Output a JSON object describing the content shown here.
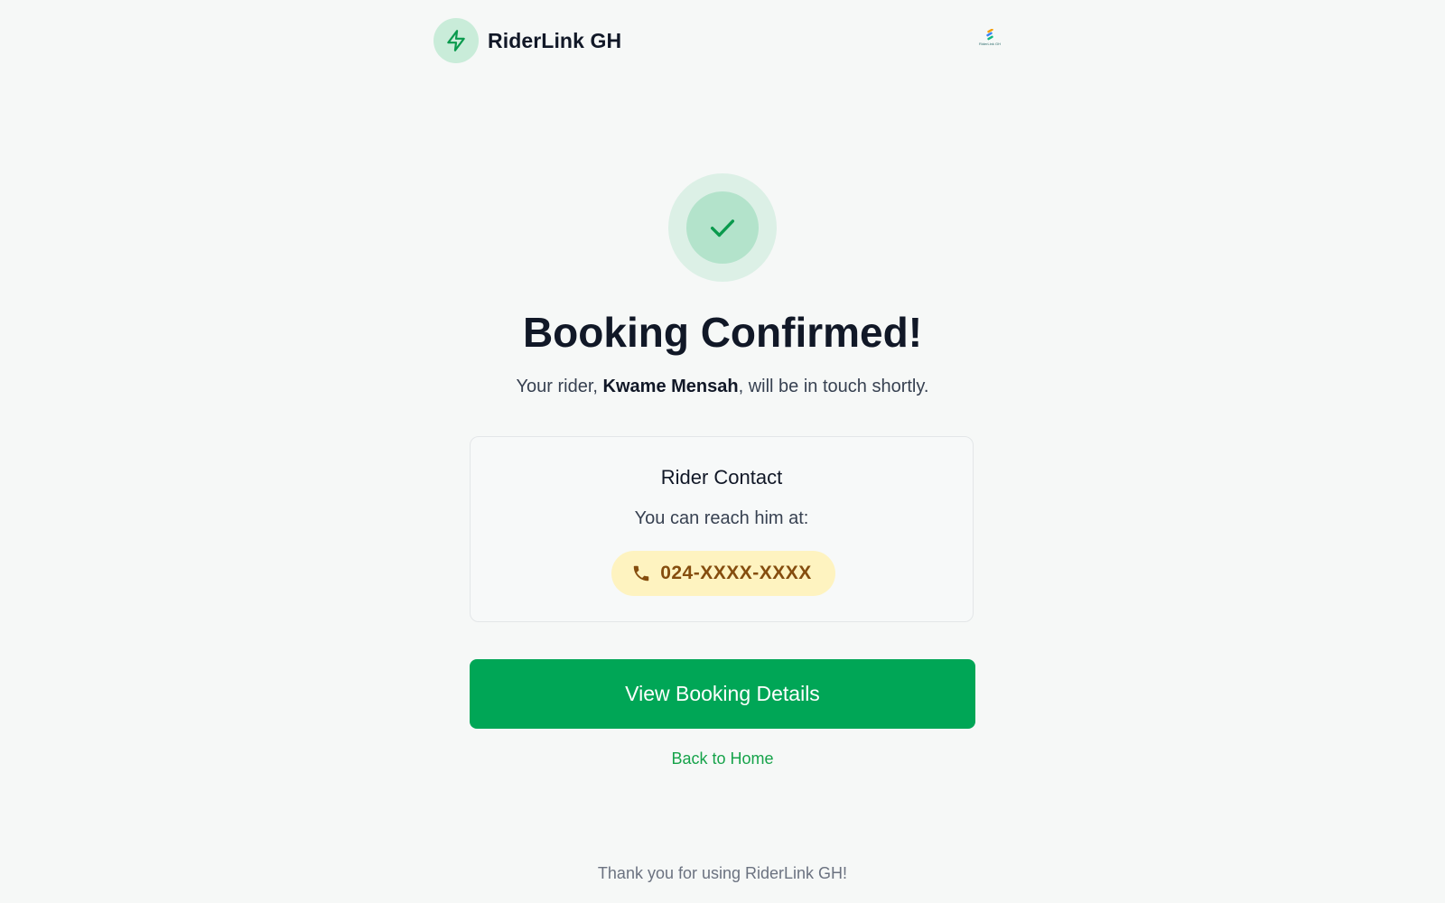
{
  "header": {
    "brand_name": "RiderLink GH",
    "brand_icon": "lightning-bolt-icon",
    "mini_logo_text": "RiderLink GH"
  },
  "confirmation": {
    "icon": "checkmark-icon",
    "title": "Booking Confirmed!",
    "subtitle_prefix": "Your rider, ",
    "rider_name": "Kwame Mensah",
    "subtitle_suffix": ", will be in touch shortly."
  },
  "contact_card": {
    "title": "Rider Contact",
    "text": "You can reach him at:",
    "phone_icon": "phone-icon",
    "phone_number": "024-XXXX-XXXX"
  },
  "actions": {
    "view_details_label": "View Booking Details",
    "back_home_label": "Back to Home"
  },
  "footer": {
    "text": "Thank you for using RiderLink GH!"
  },
  "colors": {
    "accent": "#00a656",
    "link": "#16a34a",
    "phone_pill_bg": "#fef3c0",
    "phone_text": "#854d0e",
    "background": "#f6f8f7"
  }
}
